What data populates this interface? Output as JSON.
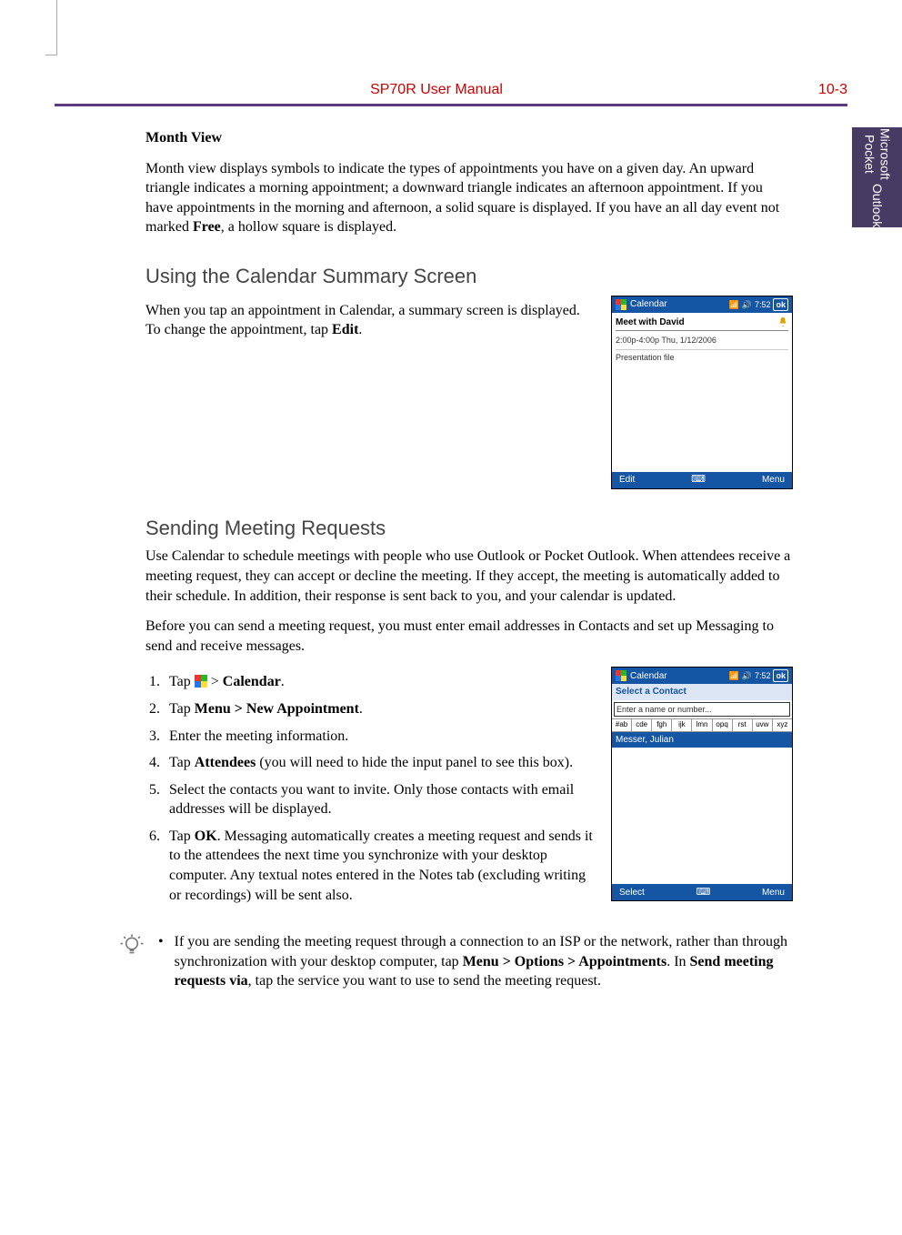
{
  "header": {
    "title": "SP70R User Manual",
    "page": "10-3"
  },
  "sideTab": {
    "line1": "Microsoft Pocket",
    "line2": "Outlook"
  },
  "monthView": {
    "heading": "Month View",
    "body_part1": "Month view displays symbols to indicate the types of appointments you have on a given day. An upward triangle indicates a morning appointment; a downward triangle indicates an afternoon appointment. If you have appointments in the morning and afternoon, a solid square is displayed. If you have an all day event not marked ",
    "body_bold": "Free",
    "body_part2": ", a hollow square is displayed."
  },
  "summary": {
    "heading": "Using the Calendar Summary Screen",
    "body_part1": "When you tap an appointment in Calendar, a summary screen is displayed. To change the appointment, tap ",
    "body_bold": "Edit",
    "body_part2": "."
  },
  "screenshot1": {
    "app": "Calendar",
    "time": "7:52",
    "ok": "ok",
    "subject": "Meet with David",
    "datetime": "2:00p-4:00p Thu, 1/12/2006",
    "note": "Presentation file",
    "left_btn": "Edit",
    "right_btn": "Menu"
  },
  "meeting": {
    "heading": "Sending Meeting Requests",
    "para1": "Use Calendar to schedule meetings with people who use Outlook or Pocket Outlook. When attendees receive a meeting request, they can accept or decline the meeting. If they accept, the meeting is automatically added to their schedule. In addition, their response is sent back to you, and your calendar is updated.",
    "para2": "Before you can send a meeting request, you must enter email addresses in Contacts and set up Messaging to send and receive messages."
  },
  "steps": {
    "s1_a": "Tap ",
    "s1_b": " > ",
    "s1_bold": "Calendar",
    "s1_c": ".",
    "s2_a": "Tap ",
    "s2_bold": "Menu > New Appointment",
    "s2_b": ".",
    "s3": "Enter the meeting information.",
    "s4_a": "Tap ",
    "s4_bold": "Attendees",
    "s4_b": " (you will need to hide the input panel to see this box).",
    "s5": "Select the contacts you want to invite. Only those contacts with email addresses will be displayed.",
    "s6_a": "Tap ",
    "s6_bold": "OK",
    "s6_b": ". Messaging automatically creates a meeting request and sends it to the attendees the next time you synchronize with your desktop computer. Any textual notes entered in the Notes tab (excluding writing or recordings) will be sent also."
  },
  "screenshot2": {
    "app": "Calendar",
    "time": "7:52",
    "ok": "ok",
    "select_label": "Select a Contact",
    "input_placeholder": "Enter a name or number...",
    "alpha": [
      "#ab",
      "cde",
      "fgh",
      "ijk",
      "lmn",
      "opq",
      "rst",
      "uvw",
      "xyz"
    ],
    "contact": "Messer, Julian",
    "left_btn": "Select",
    "right_btn": "Menu"
  },
  "tip": {
    "part1": "If you are sending the meeting request through a connection to an ISP or the network, rather than through synchronization with your desktop computer, tap ",
    "bold1": "Menu > Options > Appointments",
    "part2": ". In ",
    "bold2": "Send meeting requests via",
    "part3": ", tap the service you want to use to send the meeting request."
  }
}
